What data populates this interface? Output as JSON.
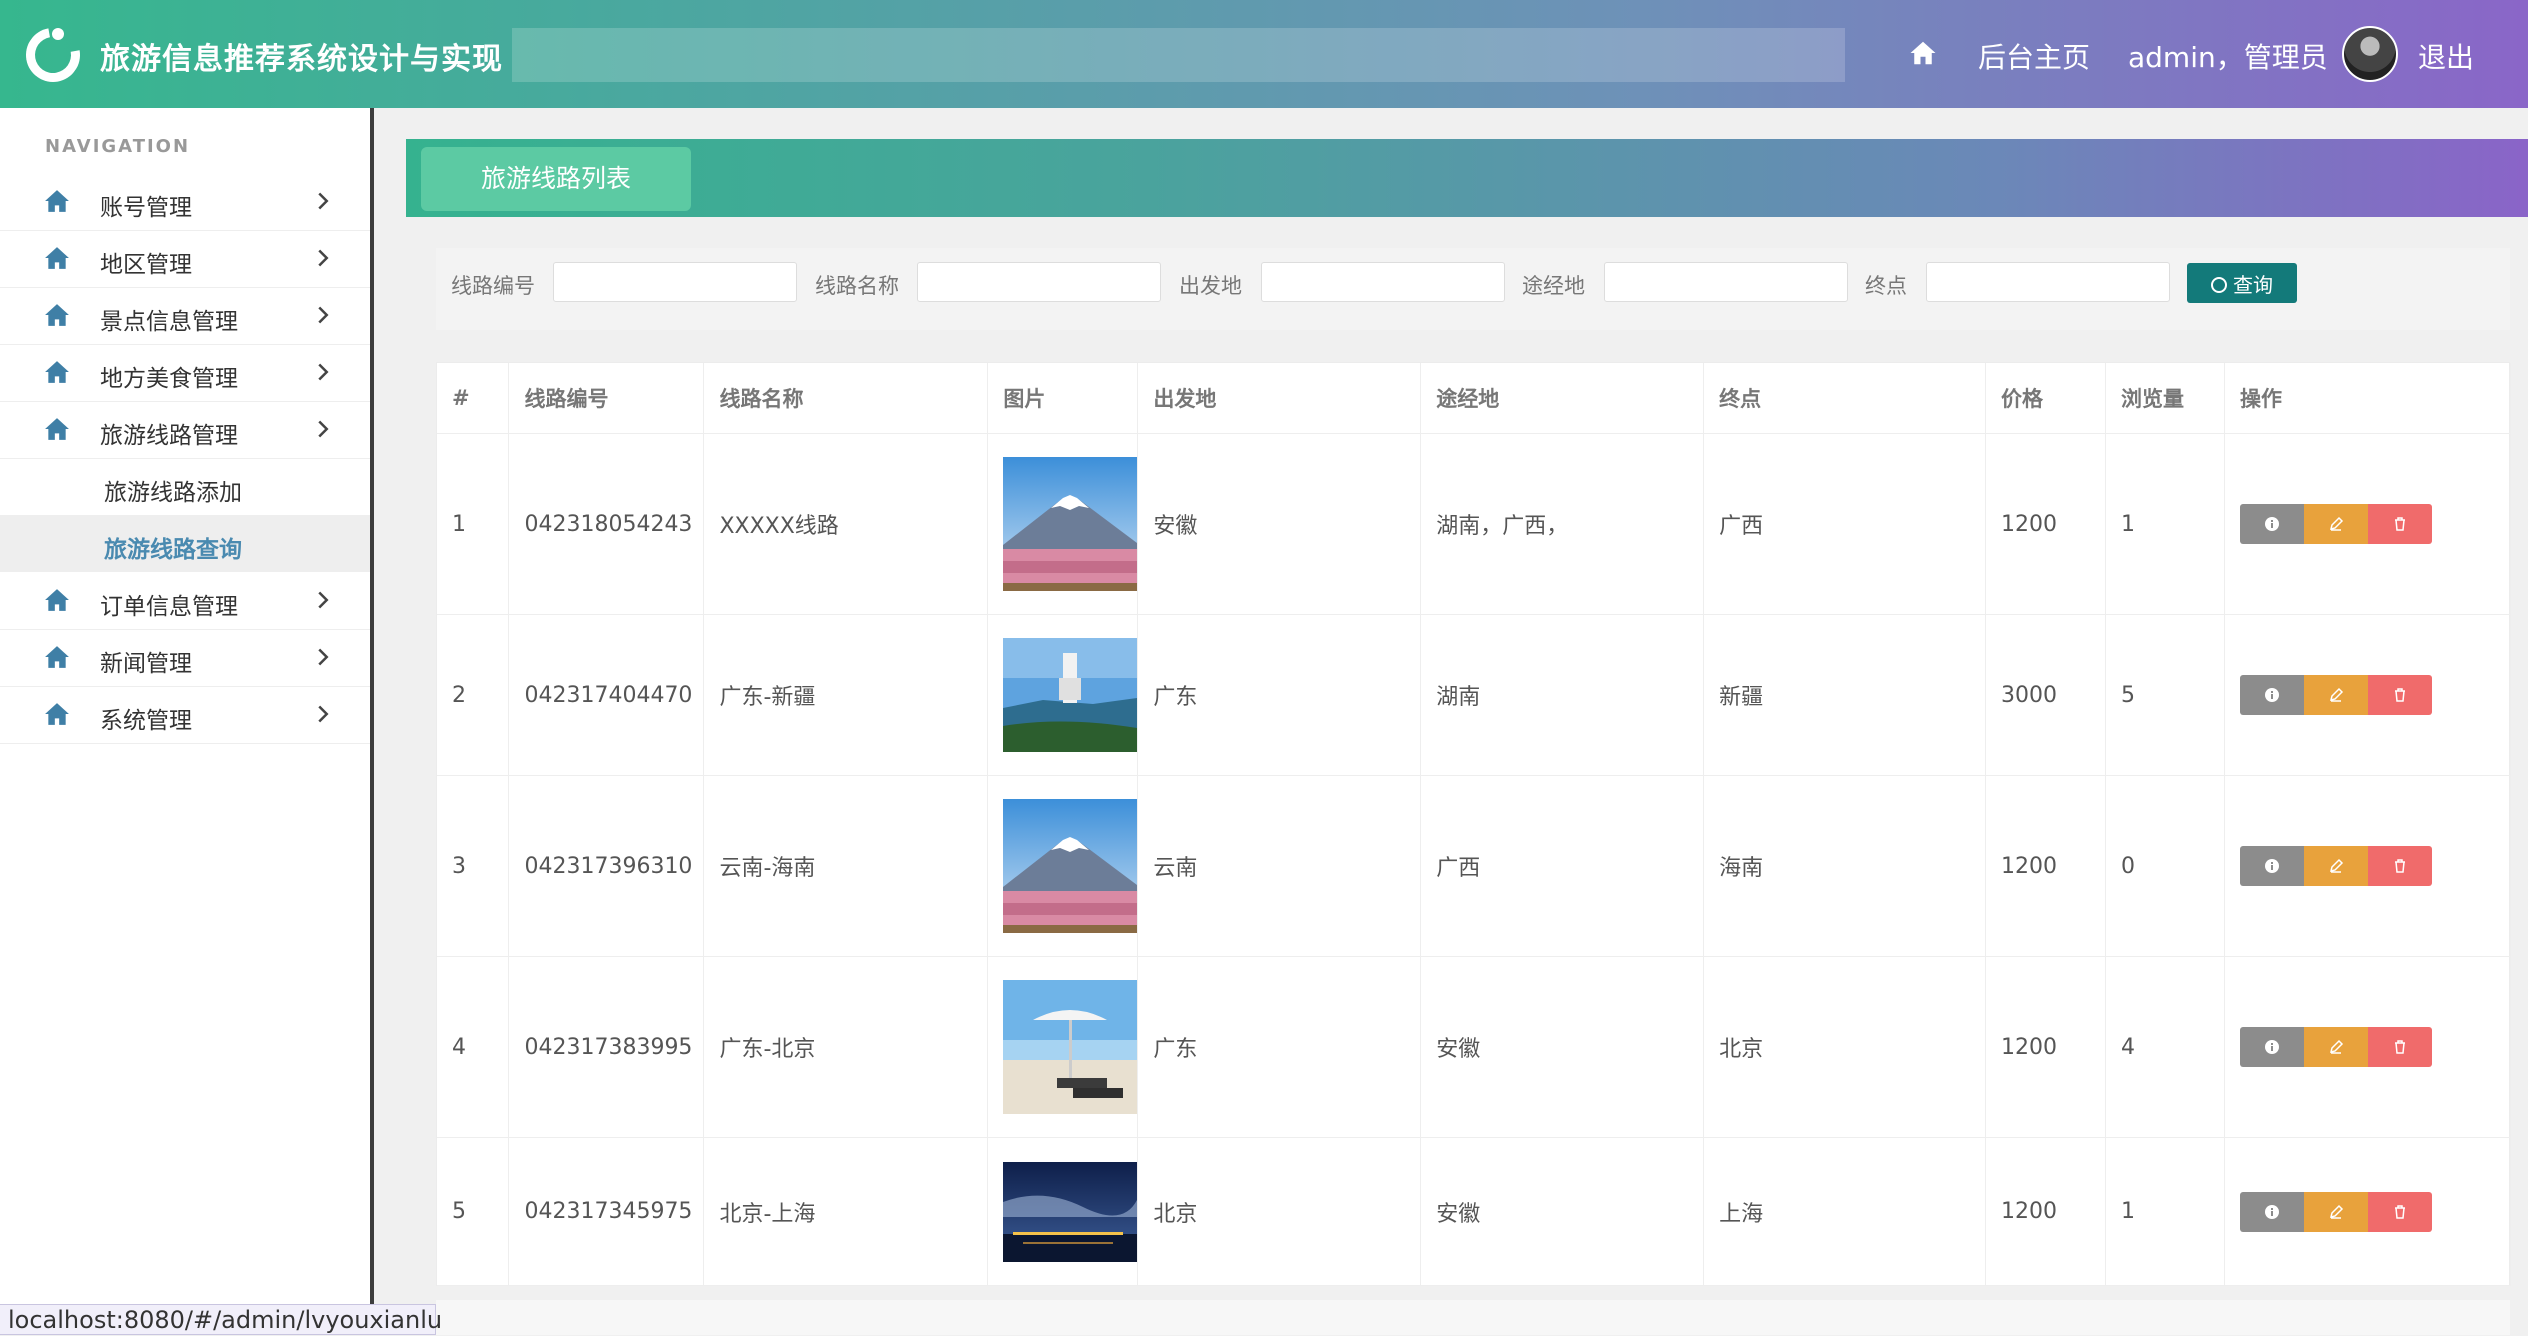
{
  "header": {
    "title": "旅游信息推荐系统设计与实现",
    "home_label": "后台主页",
    "user_label": "admin，管理员",
    "logout_label": "退出"
  },
  "sidebar": {
    "caption": "NAVIGATION",
    "items": [
      {
        "label": "账号管理",
        "icon": "home-icon"
      },
      {
        "label": "地区管理",
        "icon": "home-icon"
      },
      {
        "label": "景点信息管理",
        "icon": "home-icon"
      },
      {
        "label": "地方美食管理",
        "icon": "home-icon"
      },
      {
        "label": "旅游线路管理",
        "icon": "home-icon",
        "expanded": true
      },
      {
        "label": "订单信息管理",
        "icon": "home-icon"
      },
      {
        "label": "新闻管理",
        "icon": "home-icon"
      },
      {
        "label": "系统管理",
        "icon": "home-icon"
      }
    ],
    "submenu": [
      {
        "label": "旅游线路添加"
      },
      {
        "label": "旅游线路查询",
        "active": true
      }
    ]
  },
  "panel": {
    "tab_label": "旅游线路列表"
  },
  "filters": {
    "route_no_label": "线路编号",
    "route_name_label": "线路名称",
    "origin_label": "出发地",
    "via_label": "途经地",
    "destination_label": "终点",
    "query_label": "查询"
  },
  "table": {
    "headers": [
      "#",
      "线路编号",
      "线路名称",
      "图片",
      "出发地",
      "途经地",
      "终点",
      "价格",
      "浏览量",
      "操作"
    ],
    "rows": [
      {
        "idx": "1",
        "route_no": "042318054243",
        "name": "XXXXX线路",
        "image": "mount-fuji-cherry",
        "origin": "安徽",
        "via": "湖南，广西，",
        "destination": "广西",
        "price": "1200",
        "views": "1"
      },
      {
        "idx": "2",
        "route_no": "042317404470",
        "name": "广东-新疆",
        "image": "lighthouse-coast",
        "origin": "广东",
        "via": "湖南",
        "destination": "新疆",
        "price": "3000",
        "views": "5"
      },
      {
        "idx": "3",
        "route_no": "042317396310",
        "name": "云南-海南",
        "image": "mount-fuji-cherry",
        "origin": "云南",
        "via": "广西",
        "destination": "海南",
        "price": "1200",
        "views": "0"
      },
      {
        "idx": "4",
        "route_no": "042317383995",
        "name": "广东-北京",
        "image": "beach-umbrella",
        "origin": "广东",
        "via": "安徽",
        "destination": "北京",
        "price": "1200",
        "views": "4"
      },
      {
        "idx": "5",
        "route_no": "042317345975",
        "name": "北京-上海",
        "image": "night-harbor",
        "origin": "北京",
        "via": "安徽",
        "destination": "上海",
        "price": "1200",
        "views": "1"
      }
    ]
  },
  "status_bar": {
    "url": "localhost:8080/#/admin/lvyouxianlu"
  }
}
